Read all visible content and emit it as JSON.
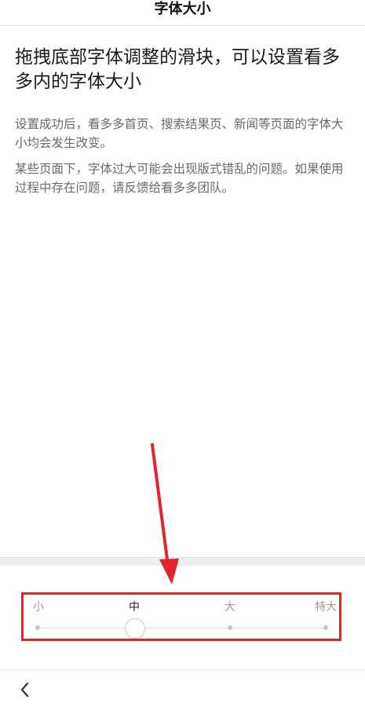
{
  "header": {
    "title": "字体大小"
  },
  "content": {
    "heading": "拖拽底部字体调整的滑块，可以设置看多多内的字体大小",
    "paragraph_1": "设置成功后，看多多首页、搜索结果页、新闻等页面的字体大小均会发生改变。",
    "paragraph_2": "某些页面下，字体过大可能会出现版式错乱的问题。如果使用过程中存在问题，请反馈给看多多团队。"
  },
  "slider": {
    "labels": {
      "small": "小",
      "medium": "中",
      "large": "大",
      "extra_large": "特大"
    },
    "selected": "中",
    "selected_index": 1,
    "step_count": 4
  },
  "footer": {
    "back_icon": "chevron-left-icon"
  },
  "colors": {
    "annotation": "#e3242b",
    "muted_text": "#6a6a6a",
    "inactive_label": "#9a9a9a"
  }
}
